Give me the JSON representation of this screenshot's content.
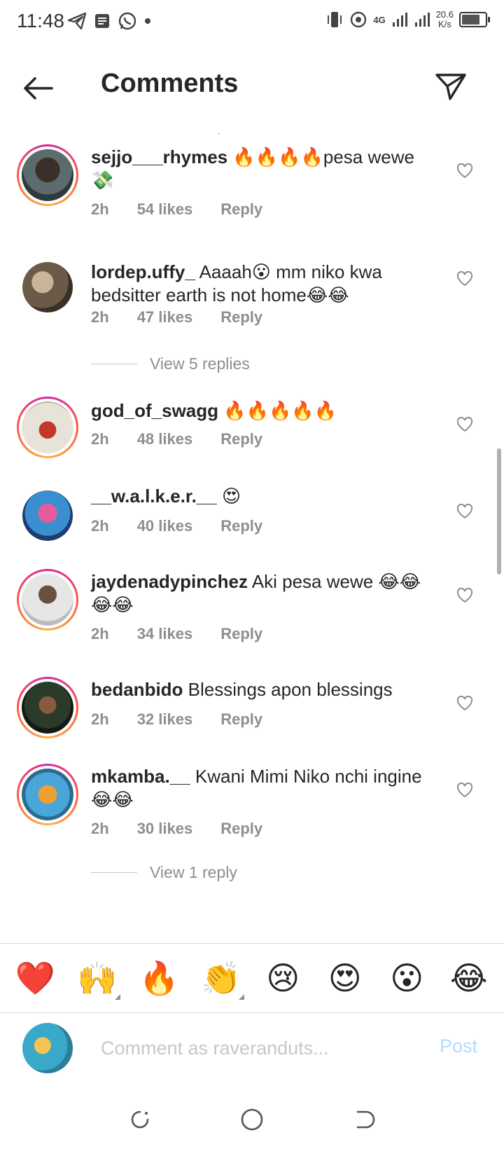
{
  "status": {
    "time": "11:48",
    "network": "4G",
    "speed_value": "20.6",
    "speed_unit": "K/s"
  },
  "header": {
    "title": "Comments"
  },
  "comments": [
    {
      "username": "sejjo___rhymes",
      "text": "🔥🔥🔥🔥pesa wewe 💸",
      "time": "2h",
      "likes": "54 likes",
      "reply": "Reply"
    },
    {
      "username": "lordep.uffy_",
      "text": "Aaaah😮 mm niko kwa bedsitter earth is not home😂😂",
      "time": "2h",
      "likes": "47 likes",
      "reply": "Reply"
    },
    {
      "username": "god_of_swagg",
      "text": "🔥🔥🔥🔥🔥",
      "time": "2h",
      "likes": "48 likes",
      "reply": "Reply"
    },
    {
      "username": "__w.a.l.k.e.r.__",
      "text": "😍",
      "time": "2h",
      "likes": "40 likes",
      "reply": "Reply"
    },
    {
      "username": "jaydenadypinchez",
      "text": "Aki pesa wewe 😂😂😂😂",
      "time": "2h",
      "likes": "34 likes",
      "reply": "Reply"
    },
    {
      "username": "bedanbido",
      "text": "Blessings apon blessings",
      "time": "2h",
      "likes": "32 likes",
      "reply": "Reply"
    },
    {
      "username": "mkamba.__",
      "text": "Kwani Mimi Niko nchi ingine😂😂",
      "time": "2h",
      "likes": "30 likes",
      "reply": "Reply"
    }
  ],
  "view_replies": [
    "View 5 replies",
    "View 1 reply"
  ],
  "emoji_bar": [
    "❤️",
    "🙌",
    "🔥",
    "👏",
    "😢",
    "😍",
    "😮",
    "😂"
  ],
  "composer": {
    "placeholder": "Comment as raveranduts...",
    "post_label": "Post"
  },
  "colors": {
    "accent_post": "#b3dbff",
    "meta_gray": "#8e8e8e",
    "story_ring": "#d6249f"
  }
}
